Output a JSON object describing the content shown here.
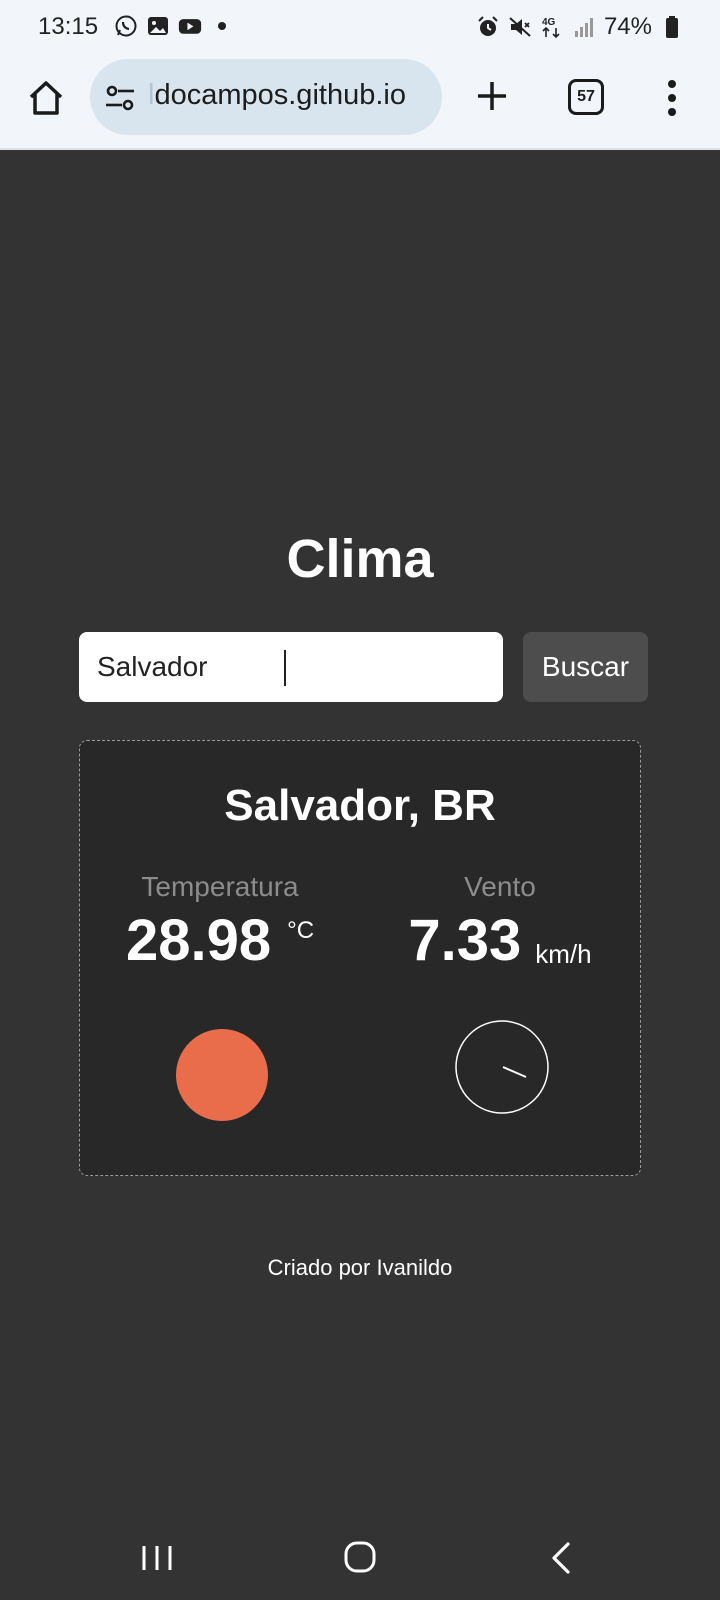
{
  "status_bar": {
    "time": "13:15",
    "battery": "74%",
    "left_icons": [
      "whatsapp-icon",
      "gallery-icon",
      "youtube-icon",
      "dot-icon"
    ],
    "right_icons": [
      "alarm-icon",
      "mute-icon",
      "4g-icon",
      "signal-icon",
      "battery-icon"
    ],
    "network": "4G"
  },
  "browser": {
    "url_fade": "l",
    "url": "docampos.github.io",
    "tab_count": "57"
  },
  "page": {
    "title": "Clima",
    "search": {
      "value": "Salvador",
      "button_label": "Buscar"
    },
    "weather": {
      "city": "Salvador, BR",
      "temperature_label": "Temperatura",
      "temperature_value": "28.98",
      "temperature_unit": "°C",
      "wind_label": "Vento",
      "wind_value": "7.33",
      "wind_unit": "km/h"
    },
    "footer": "Criado por Ivanildo"
  },
  "colors": {
    "background": "#333333",
    "card": "#282828",
    "temp_indicator": "#ea6d4b",
    "button": "#4d4d4d"
  }
}
